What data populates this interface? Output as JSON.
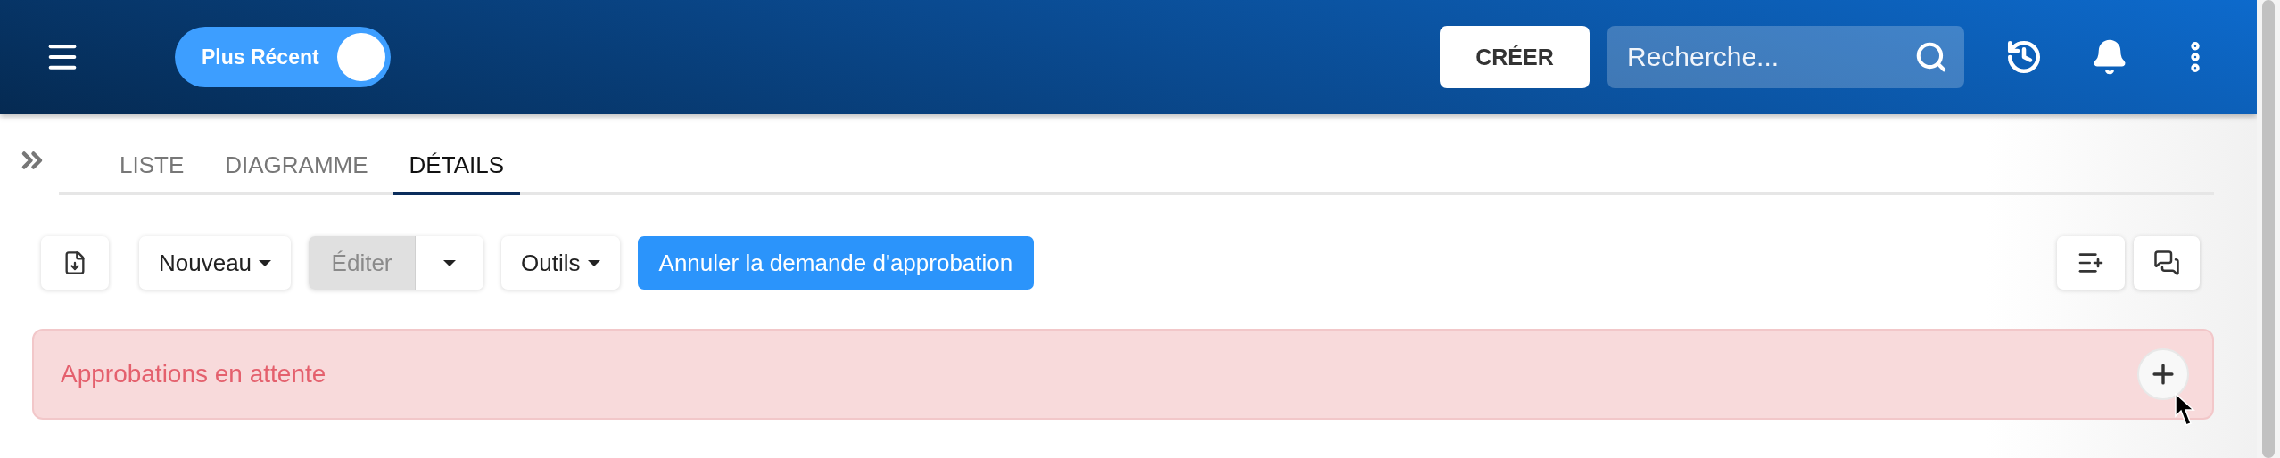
{
  "header": {
    "toggle": {
      "label": "Plus Récent",
      "on": true
    },
    "create_button": "CRÉER",
    "search": {
      "placeholder": "Recherche..."
    }
  },
  "tabs": [
    {
      "label": "LISTE",
      "selected": false
    },
    {
      "label": "DIAGRAMME",
      "selected": false
    },
    {
      "label": "DÉTAILS",
      "selected": true
    }
  ],
  "toolbar": {
    "new_menu": "Nouveau",
    "edit_button": {
      "label": "Éditer",
      "disabled": true
    },
    "tools_menu": "Outils",
    "cancel_button": "Annuler la demande d'approbation"
  },
  "alert": {
    "title": "Approbations en attente"
  }
}
